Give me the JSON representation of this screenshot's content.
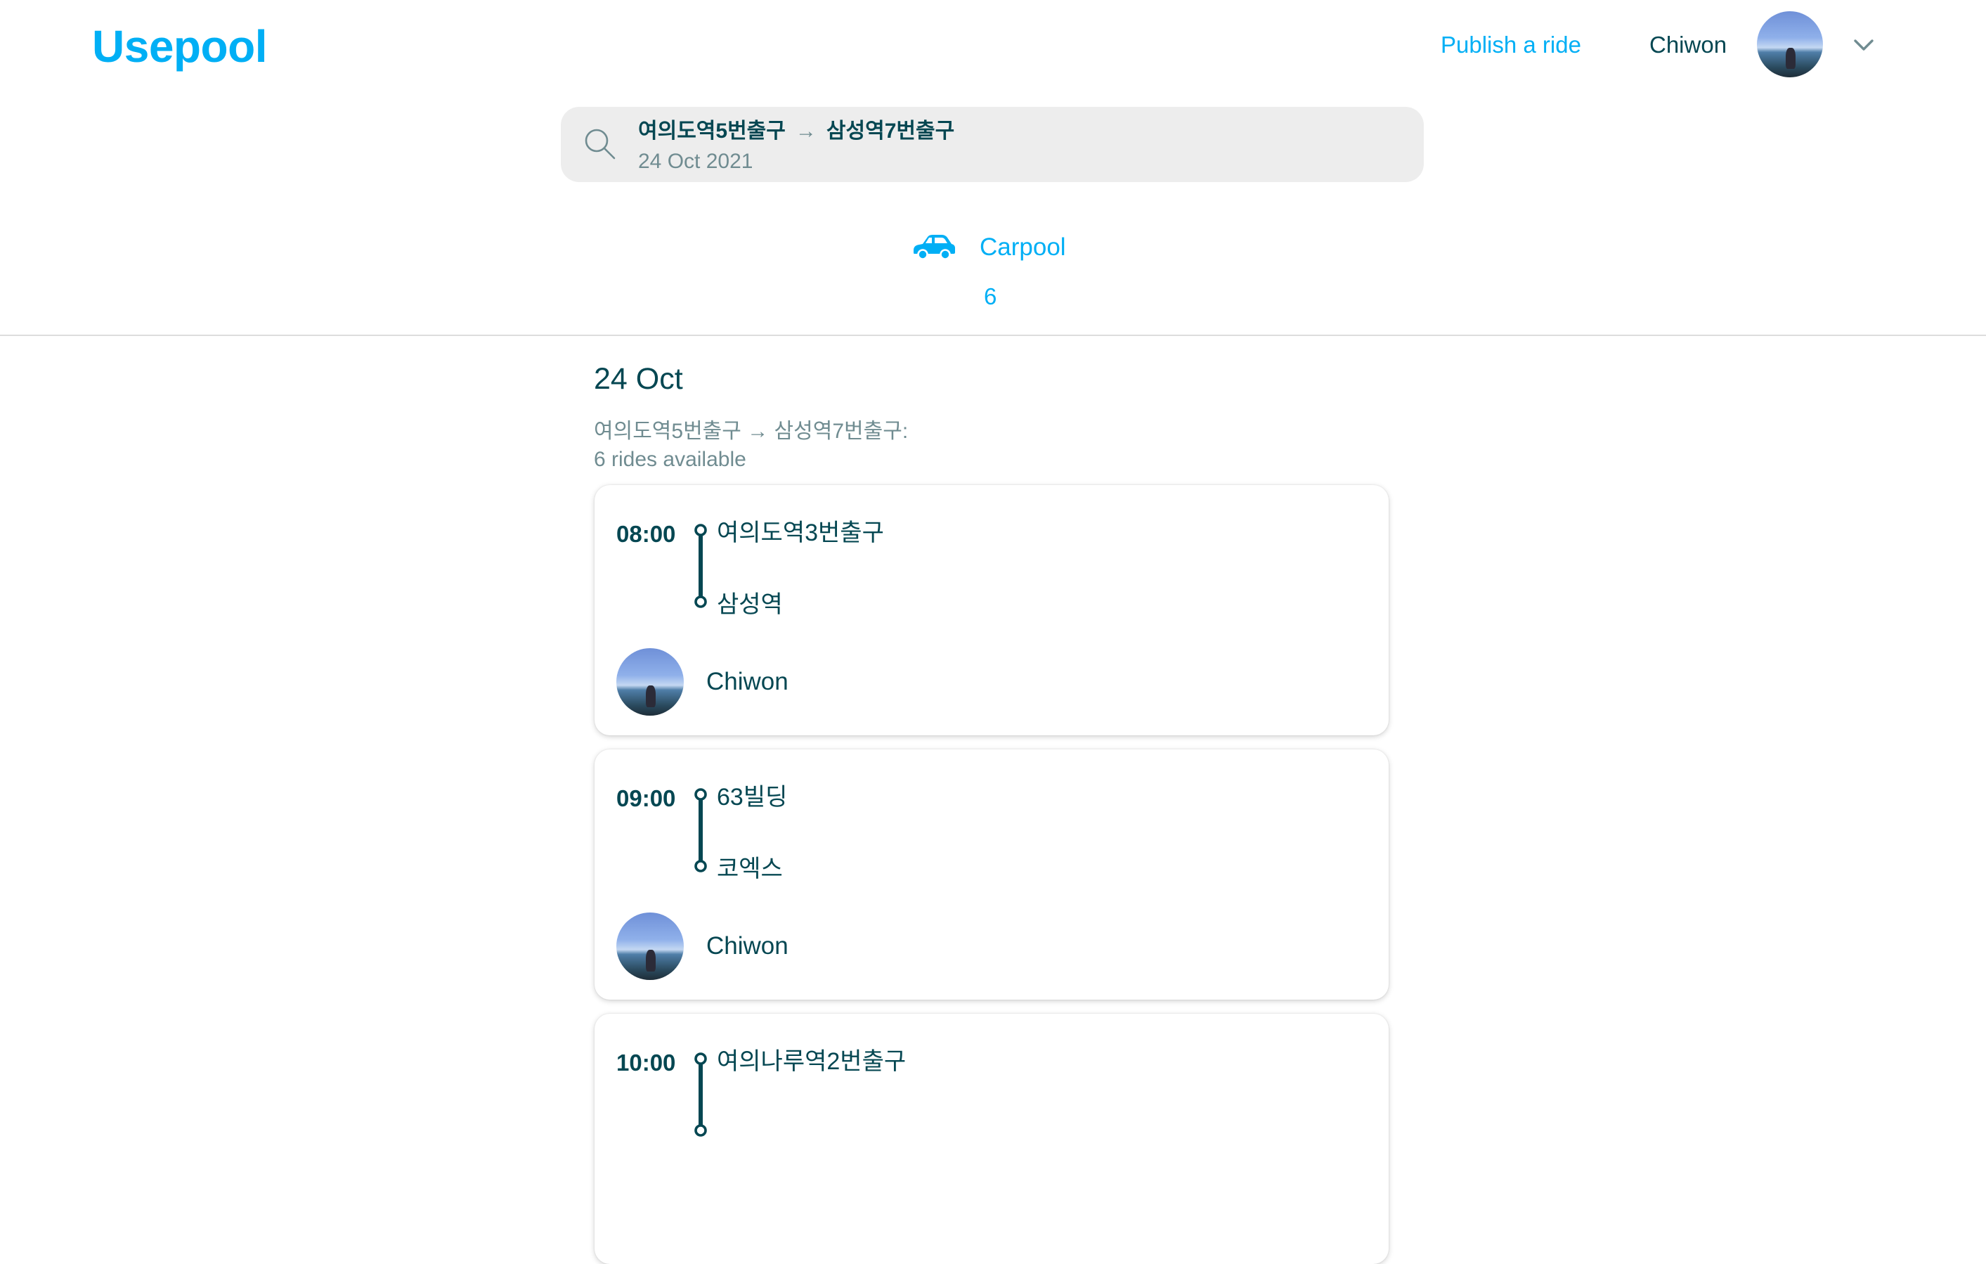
{
  "header": {
    "logo": "Usepool",
    "publish_label": "Publish a ride",
    "user_name": "Chiwon"
  },
  "search": {
    "from": "여의도역5번출구",
    "arrow": "→",
    "to": "삼성역7번출구",
    "date": "24 Oct 2021"
  },
  "tabs": [
    {
      "label": "Carpool",
      "icon": "car-icon",
      "count": "6"
    }
  ],
  "results": {
    "date_heading": "24 Oct",
    "summary_line1": "여의도역5번출구 → 삼성역7번출구:",
    "summary_line2": "6 rides available",
    "rides": [
      {
        "time": "08:00",
        "from": "여의도역3번출구",
        "to": "삼성역",
        "driver": "Chiwon"
      },
      {
        "time": "09:00",
        "from": "63빌딩",
        "to": "코엑스",
        "driver": "Chiwon"
      },
      {
        "time": "10:00",
        "from": "여의나루역2번출구",
        "to": "",
        "driver": ""
      }
    ]
  },
  "colors": {
    "brand": "#00aff5",
    "text": "#054752",
    "muted": "#708c91",
    "search_bg": "#ededed"
  }
}
